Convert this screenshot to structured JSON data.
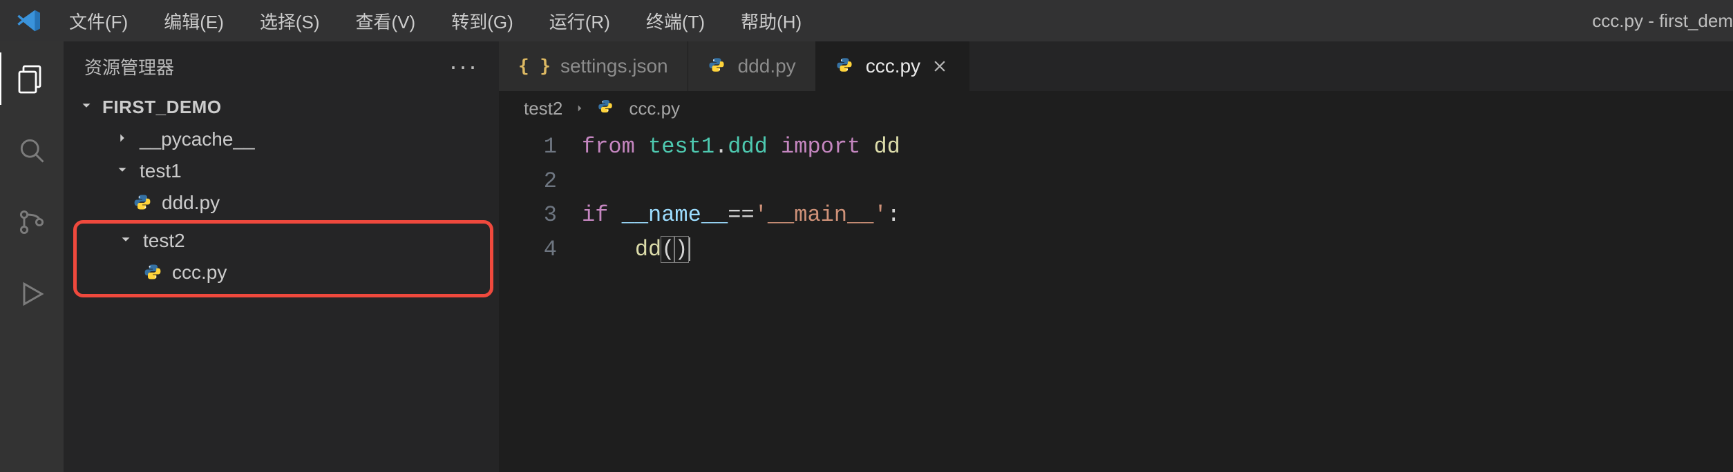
{
  "menubar": {
    "items": [
      "文件(F)",
      "编辑(E)",
      "选择(S)",
      "查看(V)",
      "转到(G)",
      "运行(R)",
      "终端(T)",
      "帮助(H)"
    ],
    "title_right": "ccc.py - first_dem"
  },
  "activitybar": {
    "items": [
      "explorer-icon",
      "search-icon",
      "scm-icon",
      "run-icon"
    ]
  },
  "sidebar": {
    "header": "资源管理器",
    "more": "···",
    "root": "FIRST_DEMO",
    "tree": {
      "pycache": "__pycache__",
      "test1": "test1",
      "dddpy": "ddd.py",
      "test2": "test2",
      "cccpy": "ccc.py"
    }
  },
  "tabs": [
    {
      "label": "settings.json",
      "icon": "json-icon",
      "active": false,
      "close": false
    },
    {
      "label": "ddd.py",
      "icon": "python-icon",
      "active": false,
      "close": false
    },
    {
      "label": "ccc.py",
      "icon": "python-icon",
      "active": true,
      "close": true
    }
  ],
  "breadcrumb": {
    "segments": [
      "test2",
      "ccc.py"
    ]
  },
  "code": {
    "lines": [
      {
        "n": "1",
        "tokens": [
          [
            "kw",
            "from"
          ],
          [
            "plain",
            " "
          ],
          [
            "mod",
            "test1"
          ],
          [
            "op",
            "."
          ],
          [
            "mod",
            "ddd"
          ],
          [
            "plain",
            " "
          ],
          [
            "kw",
            "import"
          ],
          [
            "plain",
            " "
          ],
          [
            "func",
            "dd"
          ]
        ]
      },
      {
        "n": "2",
        "tokens": []
      },
      {
        "n": "3",
        "tokens": [
          [
            "kw",
            "if"
          ],
          [
            "plain",
            " "
          ],
          [
            "const",
            "__name__"
          ],
          [
            "op",
            "=="
          ],
          [
            "str",
            "'__main__'"
          ],
          [
            "op",
            ":"
          ]
        ]
      },
      {
        "n": "4",
        "tokens": [
          [
            "plain",
            "    "
          ],
          [
            "func",
            "dd"
          ],
          [
            "paren",
            "("
          ],
          [
            "paren",
            ")"
          ],
          [
            "cursor",
            ""
          ]
        ]
      }
    ]
  }
}
